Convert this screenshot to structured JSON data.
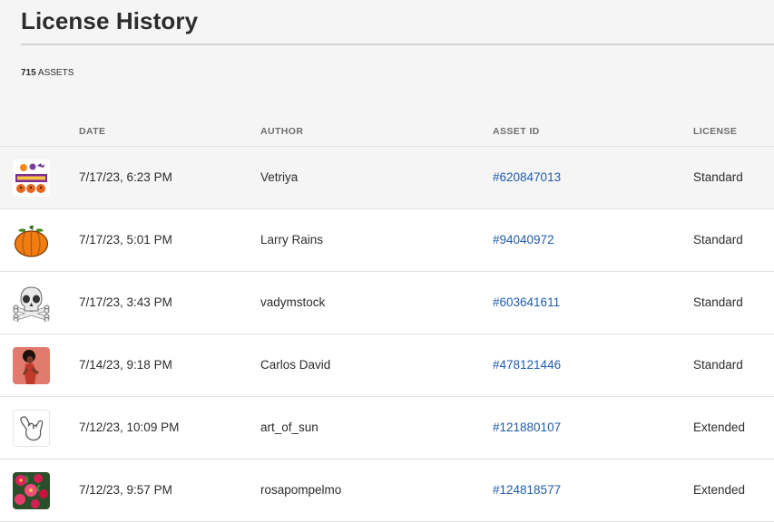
{
  "page": {
    "title": "License History",
    "asset_count": "715",
    "asset_count_label": "ASSETS"
  },
  "table": {
    "headers": {
      "date": "DATE",
      "author": "AUTHOR",
      "asset_id": "ASSET ID",
      "license": "LICENSE"
    },
    "rows": [
      {
        "thumbnail": "halloween-banner-thumbnail",
        "date": "7/17/23, 6:23 PM",
        "author": "Vetriya",
        "asset_id": "#620847013",
        "license": "Standard"
      },
      {
        "thumbnail": "pumpkin-thumbnail",
        "date": "7/17/23, 5:01 PM",
        "author": "Larry Rains",
        "asset_id": "#94040972",
        "license": "Standard"
      },
      {
        "thumbnail": "skull-crossbones-thumbnail",
        "date": "7/17/23, 3:43 PM",
        "author": "vadymstock",
        "asset_id": "#603641611",
        "license": "Standard"
      },
      {
        "thumbnail": "woman-photo-thumbnail",
        "date": "7/14/23, 9:18 PM",
        "author": "Carlos David",
        "asset_id": "#478121446",
        "license": "Standard"
      },
      {
        "thumbnail": "shaka-hand-thumbnail",
        "date": "7/12/23, 10:09 PM",
        "author": "art_of_sun",
        "asset_id": "#121880107",
        "license": "Extended"
      },
      {
        "thumbnail": "floral-pattern-thumbnail",
        "date": "7/12/23, 9:57 PM",
        "author": "rosapompelmo",
        "asset_id": "#124818577",
        "license": "Extended"
      }
    ]
  },
  "colors": {
    "background": "#f5f5f5",
    "row_background": "#ffffff",
    "link": "#1f5cab",
    "text": "#2c2c2c",
    "header_text": "#6e6e6e"
  }
}
